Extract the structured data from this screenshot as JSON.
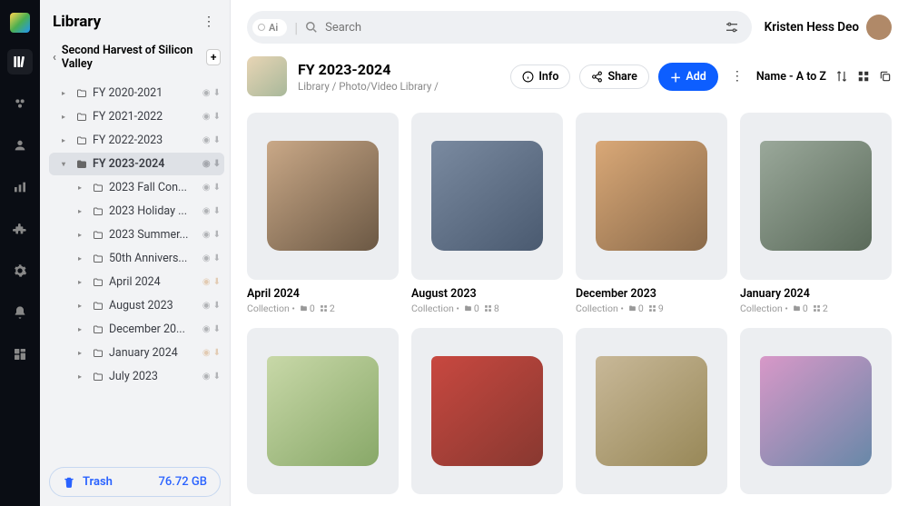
{
  "library_label": "Library",
  "org_name": "Second Harvest of Silicon Valley",
  "search_placeholder": "Search",
  "ai_label": "Ai",
  "user_name": "Kristen Hess Deo",
  "page_title": "FY 2023-2024",
  "breadcrumbs": [
    "Library",
    "Photo/Video Library",
    ""
  ],
  "actions": {
    "info": "Info",
    "share": "Share",
    "add": "Add"
  },
  "sort_label": "Name - A to Z",
  "trash": {
    "label": "Trash",
    "size": "76.72 GB"
  },
  "tree": [
    {
      "label": "FY 2020-2021",
      "depth": 0,
      "expanded": false,
      "selected": false,
      "brown": false
    },
    {
      "label": "FY 2021-2022",
      "depth": 0,
      "expanded": false,
      "selected": false,
      "brown": false
    },
    {
      "label": "FY 2022-2023",
      "depth": 0,
      "expanded": false,
      "selected": false,
      "brown": false
    },
    {
      "label": "FY 2023-2024",
      "depth": 0,
      "expanded": true,
      "selected": true,
      "brown": false
    },
    {
      "label": "2023 Fall Con...",
      "depth": 1,
      "expanded": false,
      "selected": false,
      "brown": false
    },
    {
      "label": "2023 Holiday ...",
      "depth": 1,
      "expanded": false,
      "selected": false,
      "brown": false
    },
    {
      "label": "2023 Summer...",
      "depth": 1,
      "expanded": false,
      "selected": false,
      "brown": false
    },
    {
      "label": "50th Annivers...",
      "depth": 1,
      "expanded": false,
      "selected": false,
      "brown": false
    },
    {
      "label": "April 2024",
      "depth": 1,
      "expanded": false,
      "selected": false,
      "brown": true
    },
    {
      "label": "August 2023",
      "depth": 1,
      "expanded": false,
      "selected": false,
      "brown": false
    },
    {
      "label": "December 20...",
      "depth": 1,
      "expanded": false,
      "selected": false,
      "brown": false
    },
    {
      "label": "January 2024",
      "depth": 1,
      "expanded": false,
      "selected": false,
      "brown": true
    },
    {
      "label": "July 2023",
      "depth": 1,
      "expanded": false,
      "selected": false,
      "brown": false
    }
  ],
  "cards": [
    {
      "title": "April 2024",
      "type": "Collection",
      "folders": 0,
      "items": 2,
      "bg": "linear-gradient(140deg,#c9a887,#6b5844)"
    },
    {
      "title": "August 2023",
      "type": "Collection",
      "folders": 0,
      "items": 8,
      "bg": "linear-gradient(140deg,#7a8aa0,#4a5a70)"
    },
    {
      "title": "December 2023",
      "type": "Collection",
      "folders": 0,
      "items": 9,
      "bg": "linear-gradient(140deg,#d9a877,#8a6a4a)"
    },
    {
      "title": "January 2024",
      "type": "Collection",
      "folders": 0,
      "items": 2,
      "bg": "linear-gradient(140deg,#9aa89a,#5a6a5a)"
    },
    {
      "title": "",
      "type": "",
      "folders": null,
      "items": null,
      "bg": "linear-gradient(140deg,#c8d8a8,#88a868)"
    },
    {
      "title": "",
      "type": "",
      "folders": null,
      "items": null,
      "bg": "linear-gradient(140deg,#c84840,#883830)"
    },
    {
      "title": "",
      "type": "",
      "folders": null,
      "items": null,
      "bg": "linear-gradient(140deg,#c8b898,#988858)"
    },
    {
      "title": "",
      "type": "",
      "folders": null,
      "items": null,
      "bg": "linear-gradient(140deg,#d898c8,#6888a8)"
    }
  ]
}
